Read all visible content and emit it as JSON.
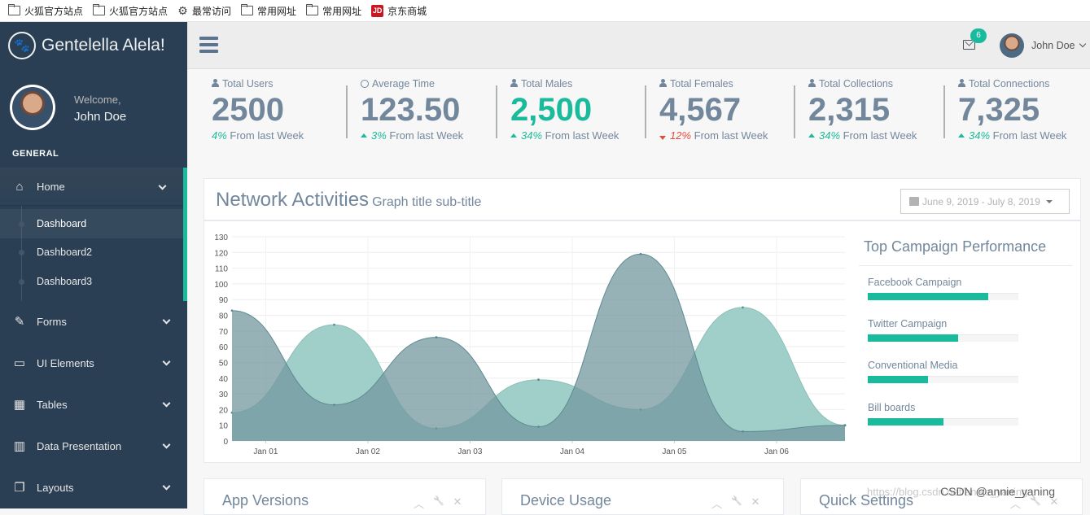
{
  "bookmarks": [
    {
      "label": "火狐官方站点",
      "icon": "folder-icon"
    },
    {
      "label": "火狐官方站点",
      "icon": "folder-icon"
    },
    {
      "label": "最常访问",
      "icon": "gear-icon"
    },
    {
      "label": "常用网址",
      "icon": "folder-icon"
    },
    {
      "label": "常用网址",
      "icon": "folder-icon"
    },
    {
      "label": "京东商城",
      "icon": "jd-icon",
      "icon_text": "JD"
    }
  ],
  "sidebar": {
    "brand": "Gentelella Alela!",
    "welcome": "Welcome,",
    "user": "John Doe",
    "section": "GENERAL",
    "home": {
      "label": "Home",
      "icon": "home-icon"
    },
    "sub_items": [
      "Dashboard",
      "Dashboard2",
      "Dashboard3"
    ],
    "items": [
      {
        "label": "Forms",
        "icon": "edit-icon",
        "glyph": "✎"
      },
      {
        "label": "UI Elements",
        "icon": "desktop-icon",
        "glyph": "▭"
      },
      {
        "label": "Tables",
        "icon": "table-icon",
        "glyph": "▦"
      },
      {
        "label": "Data Presentation",
        "icon": "bar-chart-icon",
        "glyph": "▥"
      },
      {
        "label": "Layouts",
        "icon": "clone-icon",
        "glyph": "❐"
      }
    ]
  },
  "topnav": {
    "mail_count": "6",
    "user": "John Doe"
  },
  "stats": [
    {
      "label": "Total Users",
      "icon": "user-icon",
      "value": "2500",
      "change": "4%",
      "trend": "none",
      "suffix": "From last Week",
      "highlight": false
    },
    {
      "label": "Average Time",
      "icon": "clock-icon",
      "value": "123.50",
      "change": "3%",
      "trend": "up",
      "suffix": "From last Week",
      "highlight": false
    },
    {
      "label": "Total Males",
      "icon": "user-icon",
      "value": "2,500",
      "change": "34%",
      "trend": "up",
      "suffix": "From last Week",
      "highlight": true
    },
    {
      "label": "Total Females",
      "icon": "user-icon",
      "value": "4,567",
      "change": "12%",
      "trend": "down",
      "suffix": "From last Week",
      "highlight": false
    },
    {
      "label": "Total Collections",
      "icon": "user-icon",
      "value": "2,315",
      "change": "34%",
      "trend": "up",
      "suffix": "From last Week",
      "highlight": false
    },
    {
      "label": "Total Connections",
      "icon": "user-icon",
      "value": "7,325",
      "change": "34%",
      "trend": "up",
      "suffix": "From last Week",
      "highlight": false
    }
  ],
  "panel": {
    "title": "Network Activities",
    "subtitle": "Graph title sub-title",
    "date_range": "June 9, 2019 - July 8, 2019"
  },
  "chart_data": {
    "type": "area",
    "x": [
      "Jan 01",
      "Jan 02",
      "Jan 03",
      "Jan 04",
      "Jan 05",
      "Jan 06"
    ],
    "ylim": [
      0,
      130
    ],
    "yticks": [
      0,
      10,
      20,
      30,
      40,
      50,
      60,
      70,
      80,
      90,
      100,
      110,
      120,
      130
    ],
    "series": [
      {
        "color": "#96cac3",
        "opacity": 0.9,
        "points": [
          [
            0,
            18
          ],
          [
            1,
            74
          ],
          [
            2,
            8
          ],
          [
            3,
            39
          ],
          [
            4,
            20
          ],
          [
            5,
            85
          ],
          [
            6,
            10
          ]
        ]
      },
      {
        "color": "#73989f",
        "opacity": 0.75,
        "points": [
          [
            0,
            83
          ],
          [
            1,
            23
          ],
          [
            2,
            66
          ],
          [
            3,
            9
          ],
          [
            4,
            119
          ],
          [
            5,
            6
          ],
          [
            6,
            10
          ]
        ]
      }
    ],
    "grid": true
  },
  "campaigns": {
    "title": "Top Campaign Performance",
    "items": [
      {
        "label": "Facebook Campaign",
        "value": 0.8
      },
      {
        "label": "Twitter Campaign",
        "value": 0.6
      },
      {
        "label": "Conventional Media",
        "value": 0.4
      },
      {
        "label": "Bill boards",
        "value": 0.5
      }
    ]
  },
  "bottom_panels": [
    "App Versions",
    "Device Usage",
    "Quick Settings"
  ],
  "watermark": {
    "faint": "https://blog.csdn.net/annie_yaning",
    "text": "CSDN @annie_yaning"
  },
  "colors": {
    "accent": "#1abb9c",
    "sidebar": "#2a3f54",
    "text": "#73879c",
    "down": "#e74c3c"
  }
}
